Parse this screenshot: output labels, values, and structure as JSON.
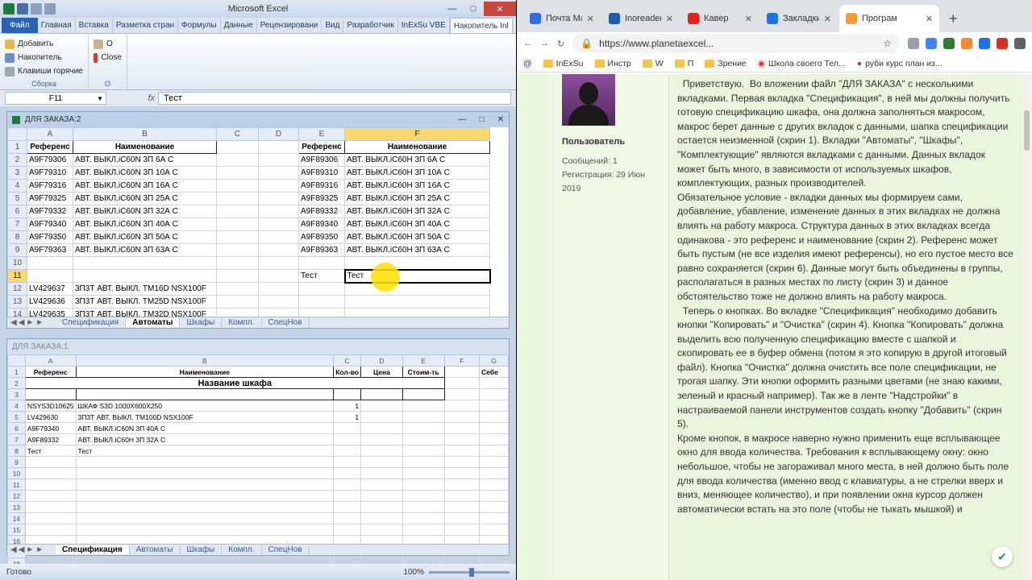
{
  "excel": {
    "title": "Microsoft Excel",
    "tabs": [
      "Файл",
      "Главная",
      "Вставка",
      "Разметка стран",
      "Формулы",
      "Данные",
      "Рецензировани",
      "Вид",
      "Разработчик",
      "InExSu VBE",
      "Накопитель Inl"
    ],
    "ribbon": {
      "group1": {
        "items": [
          "Добавить",
          "Накопитель",
          "Клавиши горячие"
        ],
        "label": "Сборка"
      },
      "group2": {
        "items": [
          "O",
          "Close"
        ],
        "label": "O"
      }
    },
    "name_box": "F11",
    "fx": "fx",
    "formula": "Тест",
    "wb1": {
      "title": "ДЛЯ ЗАКАЗА:2",
      "cols": [
        "A",
        "B",
        "C",
        "D",
        "E",
        "F"
      ],
      "rows": [
        {
          "n": "1",
          "a": "Референс",
          "b": "Наименование",
          "e": "Референс",
          "f": "Наименование"
        },
        {
          "n": "2",
          "a": "A9F79306",
          "b": "АВТ. ВЫКЛ.iC60N 3П 6А С",
          "e": "A9F89306",
          "f": "АВТ. ВЫКЛ.iC60H 3П 6А С"
        },
        {
          "n": "3",
          "a": "A9F79310",
          "b": "АВТ. ВЫКЛ.iC60N 3П 10А С",
          "e": "A9F89310",
          "f": "АВТ. ВЫКЛ.iC60H 3П 10А С"
        },
        {
          "n": "4",
          "a": "A9F79316",
          "b": "АВТ. ВЫКЛ.iC60N 3П 16А С",
          "e": "A9F89316",
          "f": "АВТ. ВЫКЛ.iC60H 3П 16А С"
        },
        {
          "n": "5",
          "a": "A9F79325",
          "b": "АВТ. ВЫКЛ.iC60N 3П 25А С",
          "e": "A9F89325",
          "f": "АВТ. ВЫКЛ.iC60H 3П 25А С"
        },
        {
          "n": "6",
          "a": "A9F79332",
          "b": "АВТ. ВЫКЛ.iC60N 3П 32А С",
          "e": "A9F89332",
          "f": "АВТ. ВЫКЛ.iC60H 3П 32А С"
        },
        {
          "n": "7",
          "a": "A9F79340",
          "b": "АВТ. ВЫКЛ.iC60N 3П 40А С",
          "e": "A9F89340",
          "f": "АВТ. ВЫКЛ.iC60H 3П 40А С"
        },
        {
          "n": "8",
          "a": "A9F79350",
          "b": "АВТ. ВЫКЛ.iC60N 3П 50А С",
          "e": "A9F89350",
          "f": "АВТ. ВЫКЛ.iC60H 3П 50А С"
        },
        {
          "n": "9",
          "a": "A9F79363",
          "b": "АВТ. ВЫКЛ.iC60N 3П 63А С",
          "e": "A9F89363",
          "f": "АВТ. ВЫКЛ.iC60H 3П 63А С"
        },
        {
          "n": "10",
          "a": "",
          "b": "",
          "e": "",
          "f": ""
        },
        {
          "n": "11",
          "a": "",
          "b": "",
          "e": "Тест",
          "f": "Тест"
        },
        {
          "n": "12",
          "a": "LV429637",
          "b": "3П3Т АВТ. ВЫКЛ. TM16D NSX100F",
          "e": "",
          "f": ""
        },
        {
          "n": "13",
          "a": "LV429636",
          "b": "3П3Т АВТ. ВЫКЛ. TM25D NSX100F",
          "e": "",
          "f": ""
        },
        {
          "n": "14",
          "a": "LV429635",
          "b": "3П3Т АВТ. ВЫКЛ. TM32D NSX100F",
          "e": "",
          "f": ""
        }
      ],
      "sheets": [
        "Спецификация",
        "Автоматы",
        "Шкафы",
        "Компл.",
        "СпецНов"
      ],
      "active_sheet": "Автоматы"
    },
    "wb2": {
      "title": "ДЛЯ ЗАКАЗА:1",
      "cols": [
        "A",
        "B",
        "C",
        "D",
        "E",
        "F",
        "G"
      ],
      "header": {
        "a": "Референс",
        "b": "Наименование",
        "c": "Кол-во",
        "d": "Цена",
        "e": "Стоим-ть",
        "g": "Себе"
      },
      "cabinet_title": "Название шкафа",
      "rows": [
        {
          "n": "4",
          "a": "NSYS3D10625",
          "b": "ШКАФ S3D 1000X600X250",
          "c": "1"
        },
        {
          "n": "5",
          "a": "LV429630",
          "b": "3П3Т АВТ. ВЫКЛ. TM100D NSX100F",
          "c": "1"
        },
        {
          "n": "6",
          "a": "A9F79340",
          "b": "АВТ. ВЫКЛ.iC60N 3П 40А С",
          "c": ""
        },
        {
          "n": "7",
          "a": "A9F89332",
          "b": "АВТ. ВЫКЛ.iC60H 3П 32А С",
          "c": ""
        },
        {
          "n": "8",
          "a": "Тест",
          "b": "Тест",
          "c": ""
        }
      ],
      "sheets": [
        "Спецификация",
        "Автоматы",
        "Шкафы",
        "Компл.",
        "СпецНов"
      ],
      "active_sheet": "Спецификация"
    },
    "status": {
      "ready": "Готово",
      "zoom": "100%"
    }
  },
  "chrome": {
    "tabs": [
      {
        "label": "Почта Ма",
        "color": "#2d6ee8"
      },
      {
        "label": "Inoreader",
        "color": "#1a5fb4"
      },
      {
        "label": "Кавер",
        "color": "#e62117"
      },
      {
        "label": "Закладки",
        "color": "#1a73e8"
      },
      {
        "label": "Програм",
        "color": "#f39c38"
      }
    ],
    "url": "https://www.planetaexcel...",
    "bookmarks": [
      "@",
      "InExSu",
      "Инстр",
      "W",
      "П",
      "Зрение",
      "Школа своего Тел...",
      "руби курс план из..."
    ],
    "user": {
      "name": "Пользователь",
      "messages": "Сообщений: 1",
      "registered": "Регистрация: 29 Июн 2019"
    },
    "post": [
      "  Приветствую.  Во вложении файл \"ДЛЯ ЗАКАЗА\" с несколькими вкладками. Первая вкладка \"Спецификация\", в ней мы должны получить готовую спецификацию шкафа, она должна заполняться макросом, макрос берет данные с других вкладок с данными, шапка спецификации остается неизменной (скрин 1). Вкладки \"Автоматы\", \"Шкафы\", \"Комплектующие\" являются вкладками с данными. Данных вкладок может быть много, в зависимости от используемых шкафов, комплектующих, разных производителей.",
      "Обязательное условие - вкладки данных мы формируем сами, добавление, убавление, изменение данных в этих вкладках не должна влиять на работу макроса. Структура данных в этих вкладках всегда одинакова - это референс и наименование (скрин 2). Референс может быть пустым (не все изделия имеют референсы), но его пустое место все равно сохраняется (скрин 6). Данные могут быть объединены в группы, располагаться в разных местах по листу (скрин 3) и данное обстоятельство тоже не должно влиять на работу макроса.",
      "  Теперь о кнопках. Во вкладке \"Спецификация\" необходимо добавить кнопки \"Копировать\" и \"Очистка\" (скрин 4). Кнопка \"Копировать\" должна выделить всю полученную спецификацию вместе с шапкой и скопировать ее в буфер обмена (потом я это копирую в другой итоговый файл). Кнопка \"Очистка\" должна очистить все поле спецификации, не трогая шапку. Эти кнопки оформить разными цветами (не знаю какими, зеленый и красный например). Так же в ленте \"Надстройки\" в настраиваемой панели инструментов создать кнопку \"Добавить\" (скрин 5).",
      "Кроме кнопок, в макросе наверно нужно применить еще всплывающее окно для ввода количества. Требования к всплывающему окну: окно небольшое, чтобы не загораживал много места, в ней должно быть поле для ввода количества (именно ввод с клавиатуры, а не стрелки вверх и вниз, меняющее количество), и при появлении окна курсор должен автоматически встать на это поле (чтобы не тыкать мышкой) и"
    ]
  }
}
